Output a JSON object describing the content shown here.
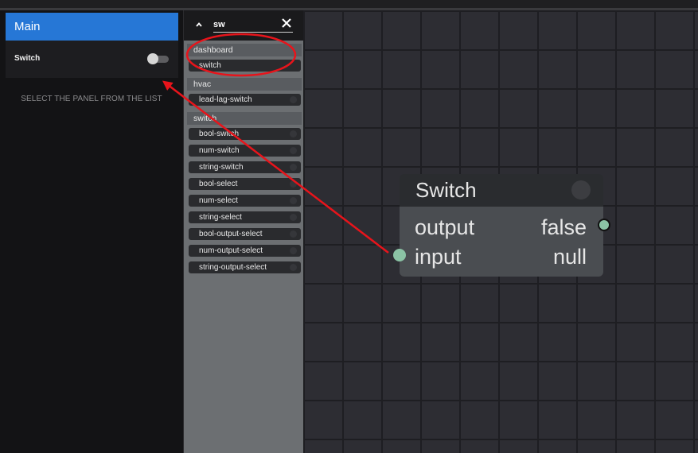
{
  "dashboard": {
    "tab_title": "Main",
    "switch_label": "Switch",
    "hint": "SELECT THE PANEL FROM THE LIST"
  },
  "node_search": {
    "query": "sw",
    "groups": [
      {
        "name": "dashboard",
        "items": [
          "switch"
        ]
      },
      {
        "name": "hvac",
        "items": [
          "lead-lag-switch"
        ]
      },
      {
        "name": "switch",
        "items": [
          "bool-switch",
          "num-switch",
          "string-switch",
          "bool-select",
          "num-select",
          "string-select",
          "bool-output-select",
          "num-output-select",
          "string-output-select"
        ]
      }
    ]
  },
  "node": {
    "title": "Switch",
    "output_label": "output",
    "output_value": "false",
    "input_label": "input",
    "input_value": "null"
  },
  "colors": {
    "accent": "#2677d6",
    "annotation": "#e8141b",
    "port": "#8bc3a5"
  }
}
